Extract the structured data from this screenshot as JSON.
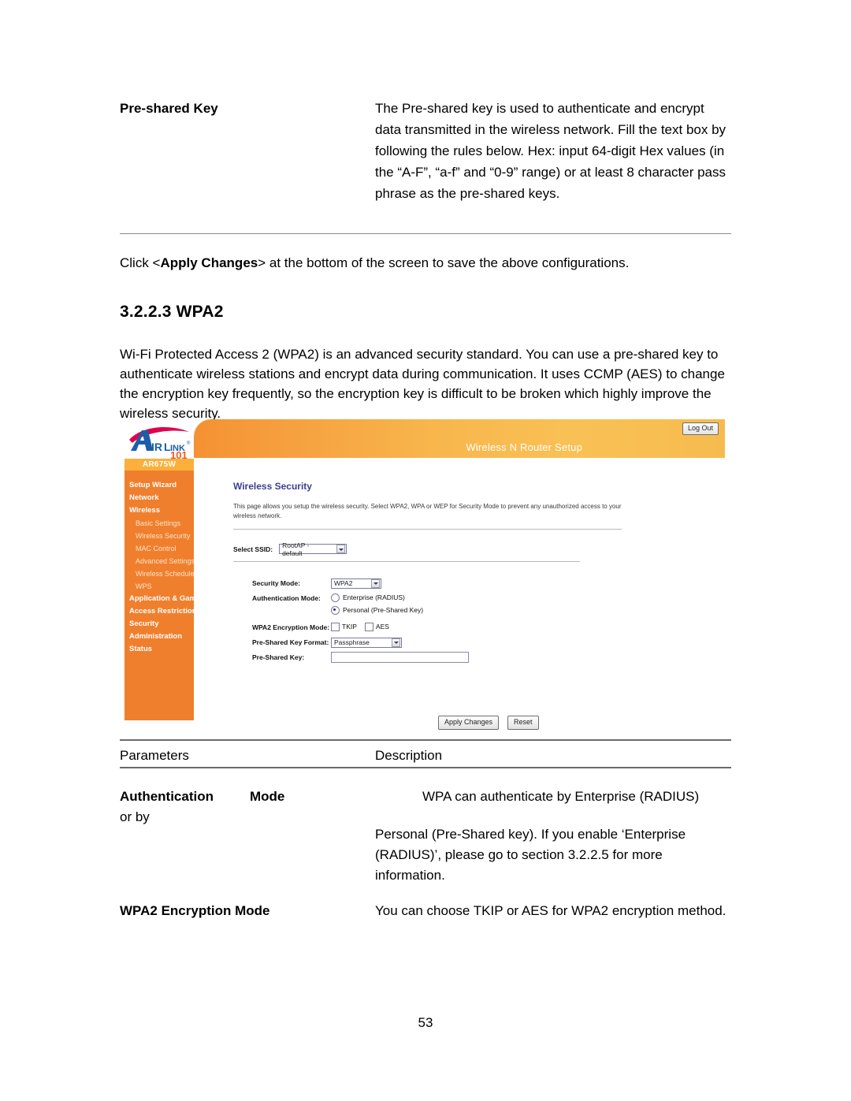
{
  "document": {
    "page_number": "53",
    "definition": {
      "term": "Pre-shared Key",
      "description": "The Pre-shared key is used to authenticate and encrypt data transmitted in the wireless network. Fill the text box by following the rules below. Hex: input 64-digit Hex values (in the “A-F”, “a-f” and “0-9” range) or at least 8 character pass phrase as the pre-shared keys."
    },
    "click_note": {
      "before": "Click <",
      "bold": "Apply Changes",
      "after": "> at the bottom of the screen to save the above configurations."
    },
    "section_heading": "3.2.2.3 WPA2",
    "intro_paragraph": "Wi-Fi Protected Access 2 (WPA2) is an advanced security standard. You can use a pre-shared key to authenticate wireless stations and encrypt data during communication. It uses CCMP (AES) to change the encryption key frequently, so the encryption key is difficult to be broken which highly improve the wireless security."
  },
  "router_ui": {
    "brand": {
      "name": "AIRLINK",
      "sub": "101",
      "trademark": "®"
    },
    "model": "AR675W",
    "header_title": "Wireless N Router Setup",
    "logout_label": "Log Out",
    "nav": [
      {
        "label": "Setup Wizard",
        "level": "top"
      },
      {
        "label": "Network",
        "level": "top"
      },
      {
        "label": "Wireless",
        "level": "top"
      },
      {
        "label": "Basic Settings",
        "level": "sub"
      },
      {
        "label": "Wireless Security",
        "level": "sub"
      },
      {
        "label": "MAC Control",
        "level": "sub"
      },
      {
        "label": "Advanced Settings",
        "level": "sub"
      },
      {
        "label": "Wireless Schedule",
        "level": "sub"
      },
      {
        "label": "WPS",
        "level": "sub"
      },
      {
        "label": "Application & Gaming",
        "level": "top"
      },
      {
        "label": "Access Restrictions",
        "level": "top"
      },
      {
        "label": "Security",
        "level": "top"
      },
      {
        "label": "Administration",
        "level": "top"
      },
      {
        "label": "Status",
        "level": "top"
      }
    ],
    "content": {
      "title": "Wireless Security",
      "description": "This page allows you setup the wireless security. Select WPA2, WPA or WEP for Security Mode to prevent any unauthorized access to your wireless network.",
      "ssid_label": "Select SSID:",
      "ssid_value": "RootAP - default",
      "security_mode_label": "Security Mode:",
      "security_mode_value": "WPA2",
      "auth_mode_label": "Authentication Mode:",
      "auth_option_enterprise": "Enterprise (RADIUS)",
      "auth_option_personal": "Personal (Pre-Shared Key)",
      "encryption_label": "WPA2 Encryption Mode:",
      "encryption_tkip": "TKIP",
      "encryption_aes": "AES",
      "psk_format_label": "Pre-Shared Key Format:",
      "psk_format_value": "Passphrase",
      "psk_label": "Pre-Shared Key:",
      "psk_value": "",
      "apply_label": "Apply Changes",
      "reset_label": "Reset"
    },
    "colors": {
      "sidebar": "#f07f2d",
      "model_band": "#fbb03b",
      "header_start": "#f59133",
      "header_end": "#f9c155",
      "title_blue": "#3b3f8c"
    }
  },
  "parameters_table": {
    "header_parameters": "Parameters",
    "header_description": "Description",
    "rows": [
      {
        "term_part1": "Authentication",
        "term_part2": "Mode",
        "term_trailing": "or by",
        "desc_line1": "WPA can authenticate by Enterprise (RADIUS)",
        "desc_rest": "Personal (Pre-Shared key). If you enable ‘Enterprise (RADIUS)’, please go to section 3.2.2.5 for more information."
      },
      {
        "term": "WPA2 Encryption Mode",
        "desc": "You can choose TKIP or AES for WPA2 encryption method."
      }
    ]
  }
}
